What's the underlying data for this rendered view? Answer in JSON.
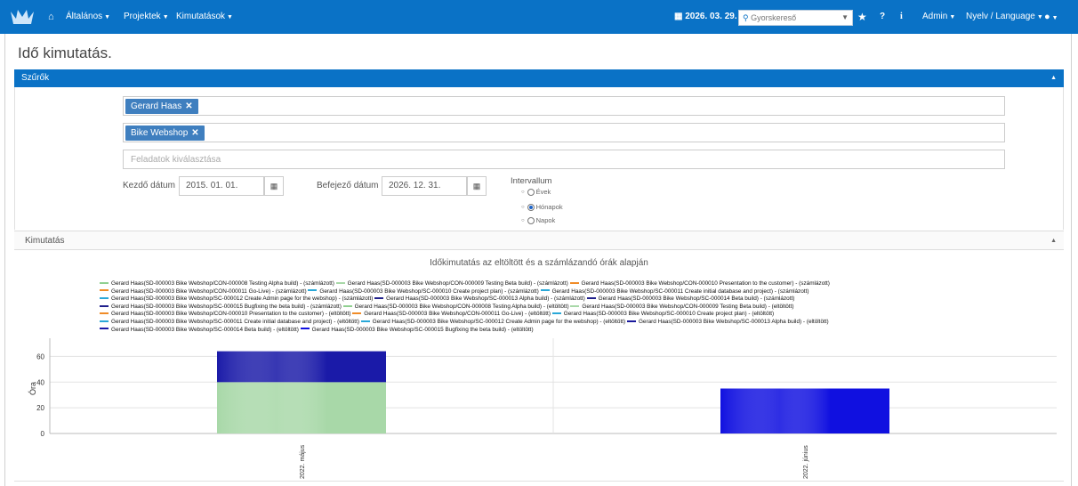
{
  "navbar": {
    "menus": [
      {
        "label": "Általános"
      },
      {
        "label": "Projektek"
      },
      {
        "label": "Kimutatások"
      }
    ],
    "date": "2026. 03. 29.",
    "search_placeholder": "Gyorskereső",
    "admin_label": "Admin",
    "language_label": "Nyelv / Language",
    "bg_color": "#0a72c6"
  },
  "page": {
    "title": "Idő kimutatás."
  },
  "filters": {
    "header": "Szűrők",
    "person_tag": "Gerard Haas",
    "project_tag": "Bike Webshop",
    "tasks_placeholder": "Feladatok kiválasztása",
    "start_label": "Kezdő dátum",
    "start_value": "2015. 01. 01.",
    "end_label": "Befejező dátum",
    "end_value": "2026. 12. 31.",
    "interval_label": "Intervallum",
    "interval_options": [
      {
        "label": "Évek",
        "checked": false
      },
      {
        "label": "Hónapok",
        "checked": true
      },
      {
        "label": "Napok",
        "checked": false
      }
    ]
  },
  "report": {
    "header": "Kimutatás"
  },
  "chart_data": {
    "type": "bar",
    "stacked": true,
    "title": "Időkimutatás az eltöltött és a számlázandó órák alapján",
    "ylabel": "Óra",
    "xlabel": "",
    "ylim": [
      0,
      70
    ],
    "yticks": [
      0,
      20,
      40,
      60
    ],
    "categories": [
      "2022. május",
      "2022. június"
    ],
    "legend_position": "top",
    "grid": true,
    "series": [
      {
        "name": "Gerard Haas(SD-000003 Bike Webshop/CON-000008 Testing Alpha build) - (számlázott)",
        "color": "#90d090",
        "values": [
          0,
          0
        ]
      },
      {
        "name": "Gerard Haas(SD-000003 Bike Webshop/CON-000009 Testing Beta build) - (számlázott)",
        "color": "#a8d8a8",
        "values": [
          40,
          0
        ]
      },
      {
        "name": "Gerard Haas(SD-000003 Bike Webshop/CON-000010 Presentation to the customer) - (számlázott)",
        "color": "#f08c28",
        "values": [
          0,
          0
        ]
      },
      {
        "name": "Gerard Haas(SD-000003 Bike Webshop/CON-000011 Go-Live) - (számlázott)",
        "color": "#f08c28",
        "values": [
          0,
          0
        ]
      },
      {
        "name": "Gerard Haas(SD-000003 Bike Webshop/SC-000010 Create project plan) - (számlázott)",
        "color": "#2aa8d8",
        "values": [
          0,
          0
        ]
      },
      {
        "name": "Gerard Haas(SD-000003 Bike Webshop/SC-000011 Create initial database and project) - (számlázott)",
        "color": "#2aa8d8",
        "values": [
          0,
          0
        ]
      },
      {
        "name": "Gerard Haas(SD-000003 Bike Webshop/SC-000012 Create Admin page for the webshop) - (számlázott)",
        "color": "#2aa8d8",
        "values": [
          0,
          0
        ]
      },
      {
        "name": "Gerard Haas(SD-000003 Bike Webshop/SC-000013 Alpha build) - (számlázott)",
        "color": "#20208c",
        "values": [
          0,
          0
        ]
      },
      {
        "name": "Gerard Haas(SD-000003 Bike Webshop/SC-000014 Beta build) - (számlázott)",
        "color": "#20208c",
        "values": [
          0,
          0
        ]
      },
      {
        "name": "Gerard Haas(SD-000003 Bike Webshop/SC-000015 Bugfixing the beta build) - (számlázott)",
        "color": "#20208c",
        "values": [
          0,
          0
        ]
      },
      {
        "name": "Gerard Haas(SD-000003 Bike Webshop/CON-000008 Testing Alpha build) - (eltöltött)",
        "color": "#90d090",
        "values": [
          0,
          0
        ]
      },
      {
        "name": "Gerard Haas(SD-000003 Bike Webshop/CON-000009 Testing Beta build) - (eltöltött)",
        "color": "#a8d8a8",
        "values": [
          0,
          0
        ]
      },
      {
        "name": "Gerard Haas(SD-000003 Bike Webshop/CON-000010 Presentation to the customer) - (eltöltött)",
        "color": "#f08c28",
        "values": [
          0,
          0
        ]
      },
      {
        "name": "Gerard Haas(SD-000003 Bike Webshop/CON-000011 Go-Live) - (eltöltött)",
        "color": "#f08c28",
        "values": [
          0,
          0
        ]
      },
      {
        "name": "Gerard Haas(SD-000003 Bike Webshop/SC-000010 Create project plan) - (eltöltött)",
        "color": "#2aa8d8",
        "values": [
          0,
          0
        ]
      },
      {
        "name": "Gerard Haas(SD-000003 Bike Webshop/SC-000011 Create initial database and project) - (eltöltött)",
        "color": "#2aa8d8",
        "values": [
          0,
          0
        ]
      },
      {
        "name": "Gerard Haas(SD-000003 Bike Webshop/SC-000012 Create Admin page for the webshop) - (eltöltött)",
        "color": "#2aa8d8",
        "values": [
          0,
          0
        ]
      },
      {
        "name": "Gerard Haas(SD-000003 Bike Webshop/SC-000013 Alpha build) - (eltöltött)",
        "color": "#1a1a9c",
        "values": [
          0,
          0
        ]
      },
      {
        "name": "Gerard Haas(SD-000003 Bike Webshop/SC-000014 Beta build) - (eltöltött)",
        "color": "#1a1aa8",
        "values": [
          24,
          0
        ]
      },
      {
        "name": "Gerard Haas(SD-000003 Bike Webshop/SC-000015 Bugfixing the beta build) - (eltöltött)",
        "color": "#1010e0",
        "values": [
          0,
          35
        ]
      }
    ]
  }
}
